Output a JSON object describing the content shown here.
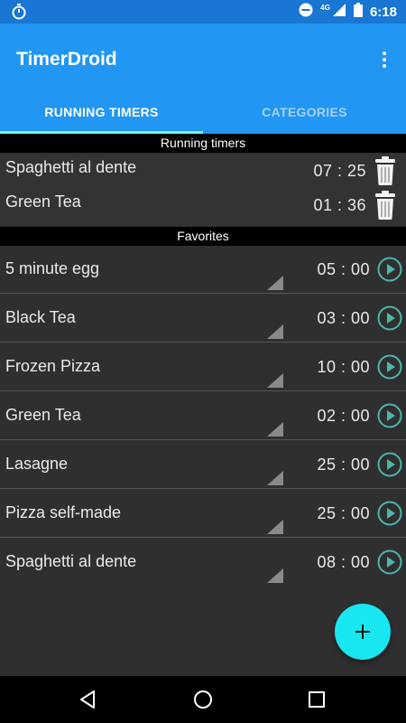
{
  "status_bar": {
    "time": "6:18",
    "network": "4G"
  },
  "app": {
    "title": "TimerDroid",
    "menu_icon": "overflow-menu-icon"
  },
  "tabs": [
    {
      "label": "RUNNING TIMERS",
      "active": true
    },
    {
      "label": "CATEGORIES",
      "active": false
    }
  ],
  "running": {
    "header": "Running timers",
    "items": [
      {
        "name": "Spaghetti al dente",
        "time": "07 : 25",
        "icon": "trash-icon"
      },
      {
        "name": "Green Tea",
        "time": "01 : 36",
        "icon": "trash-icon"
      }
    ]
  },
  "favorites": {
    "header": "Favorites",
    "items": [
      {
        "name": "5 minute egg",
        "time": "05 : 00"
      },
      {
        "name": "Black Tea",
        "time": "03 : 00"
      },
      {
        "name": "Frozen Pizza",
        "time": "10 : 00"
      },
      {
        "name": "Green Tea",
        "time": "02 : 00"
      },
      {
        "name": "Lasagne",
        "time": "25 : 00"
      },
      {
        "name": "Pizza self-made",
        "time": "25 : 00"
      },
      {
        "name": "Spaghetti al dente",
        "time": "08 : 00"
      }
    ]
  },
  "fab": {
    "icon": "plus-icon"
  },
  "colors": {
    "status_bar": "#1976d2",
    "app_bar": "#2196f3",
    "tab_indicator": "#7ff0ff",
    "fab": "#18e7f2",
    "play_accent": "#4db6ac",
    "background": "#2f2f2f"
  }
}
